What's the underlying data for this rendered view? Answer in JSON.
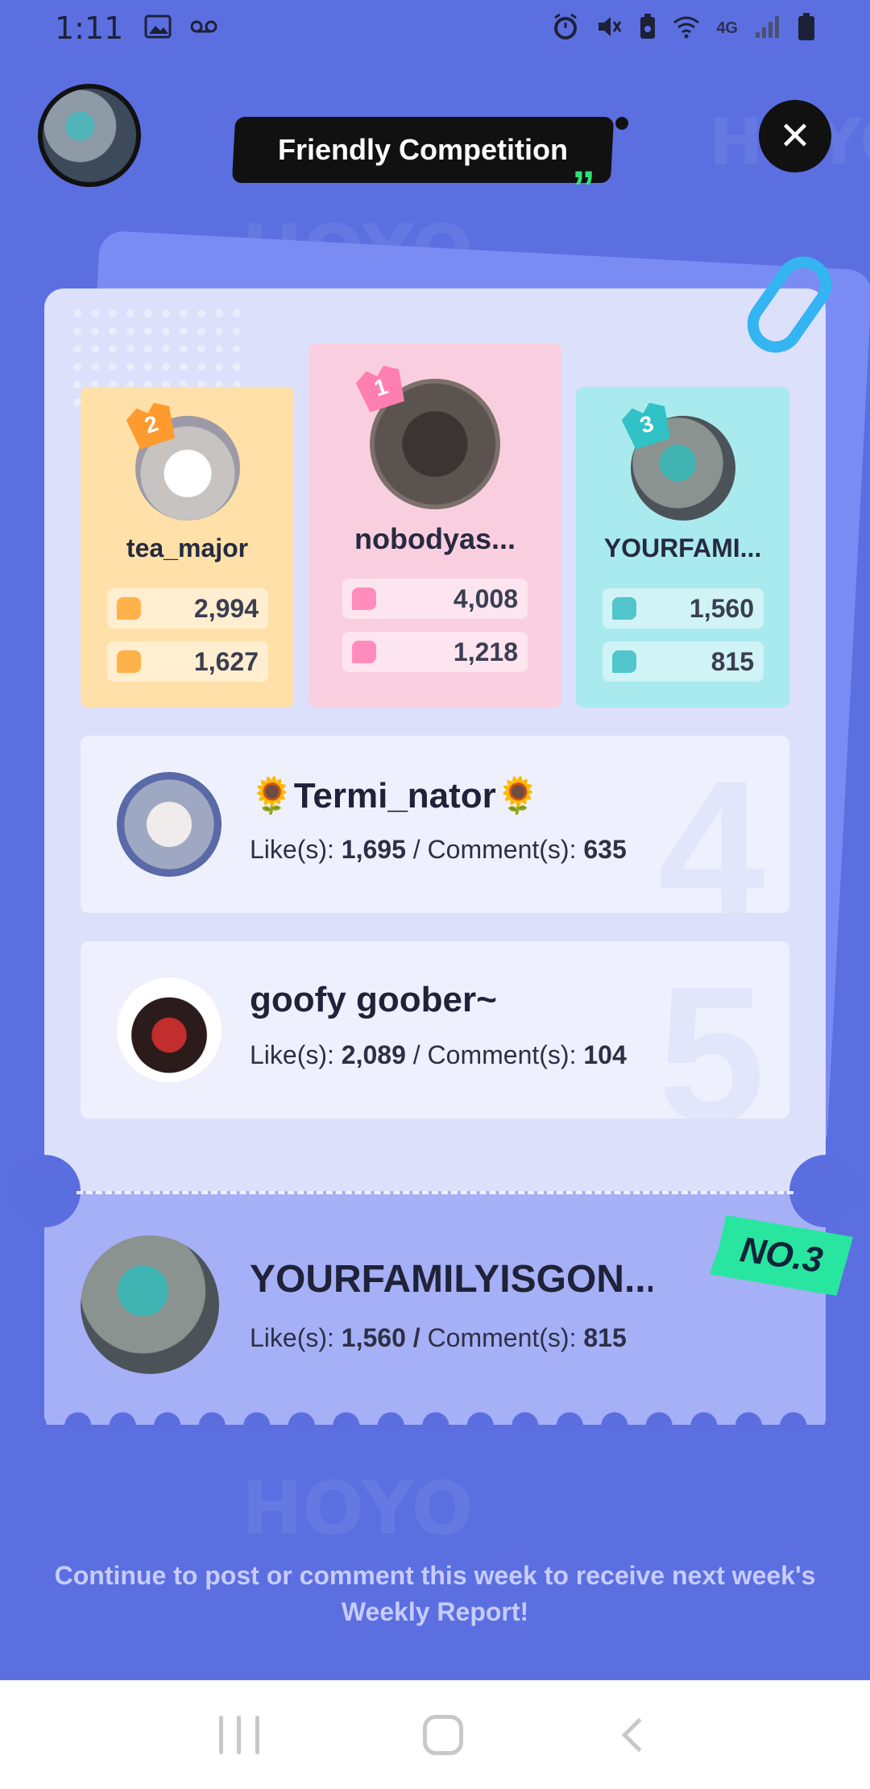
{
  "status_bar": {
    "time": "1:11",
    "lte": "4G"
  },
  "header": {
    "title": "Friendly Competition",
    "close_glyph": "✕"
  },
  "podium": {
    "first": {
      "rank": "1",
      "name": "nobodyas...",
      "likes": "4,008",
      "comments": "1,218"
    },
    "second": {
      "rank": "2",
      "name": "tea_major",
      "likes": "2,994",
      "comments": "1,627"
    },
    "third": {
      "rank": "3",
      "name": "YOURFAMI...",
      "likes": "1,560",
      "comments": "815"
    }
  },
  "ranks": [
    {
      "num": "4",
      "name": "🌻Termi_nator🌻",
      "likes_label": "Like(s):",
      "likes": "1,695",
      "separator": "/",
      "comments_label": "Comment(s):",
      "comments": "635"
    },
    {
      "num": "5",
      "name": "goofy goober~",
      "likes_label": "Like(s):",
      "likes": "2,089",
      "separator": "/",
      "comments_label": "Comment(s):",
      "comments": "104"
    }
  ],
  "me": {
    "name": "YOURFAMILYISGON...",
    "likes_label": "Like(s):",
    "likes": "1,560",
    "separator": "/",
    "comments_label": "Comment(s):",
    "comments": "815",
    "badge": "NO.3"
  },
  "footer": {
    "message": "Continue to post or comment this week to receive next week's Weekly Report!"
  },
  "colors": {
    "background": "#5b6ee0",
    "card": "#dce0fb",
    "first_place": "#f9cfe0",
    "second_place": "#ffe0a8",
    "third_place": "#a9eaee",
    "badge": "#28e6a0"
  },
  "icons": [
    "photo-icon",
    "voicemail-icon",
    "alarm-icon",
    "mute-icon",
    "battery-saver-icon",
    "wifi-icon",
    "signal-icon",
    "battery-icon",
    "like-icon",
    "comment-icon",
    "close-icon",
    "crown-icon"
  ]
}
